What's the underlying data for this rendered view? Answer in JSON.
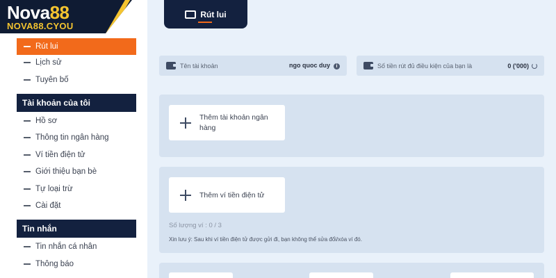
{
  "logo": {
    "name_text": "Nova",
    "name_number": "88",
    "domain": "NOVA88.CYOU"
  },
  "sidebar": {
    "items_top": [
      {
        "label": "Rút lui",
        "active": true
      },
      {
        "label": "Lịch sử",
        "active": false
      },
      {
        "label": "Tuyên bố",
        "active": false
      }
    ],
    "section_account": "Tài khoản của tôi",
    "items_account": [
      {
        "label": "Hồ sơ"
      },
      {
        "label": "Thông tin ngân hàng"
      },
      {
        "label": "Ví tiền điện tử"
      },
      {
        "label": "Giới thiệu bạn bè"
      },
      {
        "label": "Tự loại trừ"
      },
      {
        "label": "Cài đặt"
      }
    ],
    "section_messages": "Tin nhắn",
    "items_messages": [
      {
        "label": "Tin nhắn cá nhân"
      },
      {
        "label": "Thông báo"
      }
    ]
  },
  "main": {
    "tab_label": "Rút lui",
    "account_label": "Tên tài khoản",
    "account_value": "ngo quoc duy",
    "eligible_label": "Số tiền rút đủ điều kiện của bạn là",
    "eligible_value": "0 ('000)",
    "add_bank_label": "Thêm tài khoản ngân hàng",
    "add_ewallet_label": "Thêm ví tiền điện tử",
    "wallet_count": "Số lượng ví : 0 / 3",
    "note": "Xin lưu ý: Sau khi ví tiền điện tử được gửi đi, bạn không thể sửa đổi/xóa ví đó."
  },
  "colors": {
    "navy": "#13213f",
    "orange": "#f26a1b",
    "gold": "#f4c430",
    "panel": "#d6e2f0",
    "background": "#e9f1fa"
  },
  "icons": [
    "wallet-icon",
    "plus-icon",
    "info-icon",
    "refresh-icon",
    "withdraw-icon"
  ]
}
